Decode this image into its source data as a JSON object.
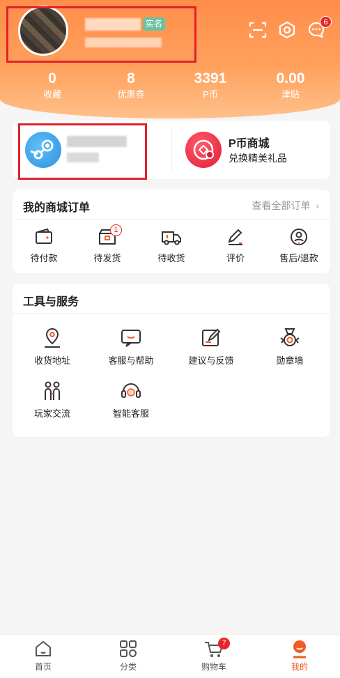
{
  "header": {
    "verify_badge": "实名",
    "message_badge": "6"
  },
  "stats": [
    {
      "value": "0",
      "label": "收藏"
    },
    {
      "value": "8",
      "label": "优惠券"
    },
    {
      "value": "3391",
      "label": "P币"
    },
    {
      "value": "0.00",
      "label": "津贴"
    }
  ],
  "quick": {
    "pcoin_title": "P币商城",
    "pcoin_sub": "兑换精美礼品"
  },
  "orders": {
    "title": "我的商城订单",
    "view_all": "查看全部订单",
    "items": [
      {
        "label": "待付款"
      },
      {
        "label": "待发货",
        "badge": "1"
      },
      {
        "label": "待收货"
      },
      {
        "label": "评价"
      },
      {
        "label": "售后/退款"
      }
    ]
  },
  "tools": {
    "title": "工具与服务",
    "items": [
      {
        "label": "收货地址"
      },
      {
        "label": "客服与帮助"
      },
      {
        "label": "建议与反馈"
      },
      {
        "label": "勋章墙"
      },
      {
        "label": "玩家交流"
      },
      {
        "label": "智能客服"
      }
    ]
  },
  "tabbar": {
    "items": [
      {
        "label": "首页"
      },
      {
        "label": "分类"
      },
      {
        "label": "购物车",
        "badge": "7"
      },
      {
        "label": "我的"
      }
    ]
  },
  "colors": {
    "accent": "#f05a22",
    "header": "#ff8d4a",
    "badge": "#e8262a"
  }
}
